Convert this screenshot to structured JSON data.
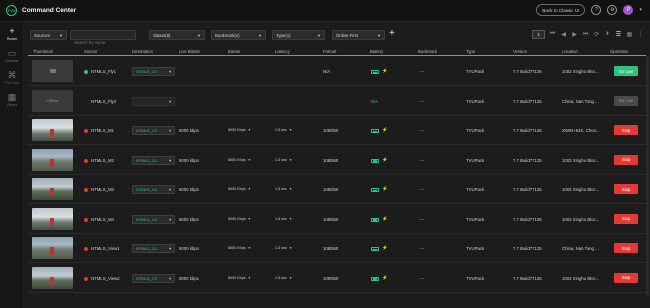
{
  "app": {
    "title": "Command Center",
    "logo_text": "TVU"
  },
  "header": {
    "back_label": "Back to Classic UI",
    "help_glyph": "?",
    "settings_glyph": "⚙",
    "user_initial": "P",
    "caret": "▾"
  },
  "sidebar": {
    "items": [
      {
        "label": "Router",
        "icon": "plus-icon",
        "glyph": "+",
        "active": true
      },
      {
        "label": "Receiver",
        "icon": "monitor-icon",
        "glyph": "▭",
        "active": false
      },
      {
        "label": "TVU Grid",
        "icon": "grid-icon",
        "glyph": "⌘",
        "active": false
      },
      {
        "label": "Others",
        "icon": "apps-icon",
        "glyph": "▦",
        "active": false
      }
    ]
  },
  "filters": {
    "sources": "Sources",
    "search_placeholder": "Search by name",
    "status": "Status(8)",
    "bookmark": "Bookmark(1)",
    "type": "Type(1)",
    "online_first": "Online First",
    "add": "+"
  },
  "tools": {
    "page": "1",
    "glyphs": [
      "⏮",
      "◀",
      "▶",
      "⏭",
      "⟳",
      "⏵",
      "☰",
      "▦",
      "⋮"
    ]
  },
  "columns": [
    "Thumbnail",
    "Source",
    "Destination",
    "Live Bitrate",
    "Bitrate",
    "Latency",
    "Format",
    "Battery",
    "Bookmark",
    "Type",
    "Version",
    "Location",
    "Operation"
  ],
  "colors": {
    "accent": "#2ec27e",
    "stop": "#e53935",
    "online": "#2ec27e",
    "live": "#e53935"
  },
  "rows": [
    {
      "thumb": "empty",
      "status": "online",
      "source": "NTMLS_Fly1",
      "destination": "NTMLS_1O",
      "dest_disabled": false,
      "live_bitrate": "",
      "bitrate": "",
      "latency": "",
      "format": "N/A",
      "battery": "",
      "bookmark": "---",
      "type": "TVUPack",
      "version": "7.7 Build77135",
      "location": "1002 Xinghu Bloc...",
      "operation": "Go Live"
    },
    {
      "thumb": "offline",
      "thumb_text": "Offline",
      "status": "none",
      "source": "NTMLS_Fly2",
      "destination": "",
      "dest_disabled": true,
      "live_bitrate": "",
      "bitrate": "",
      "latency": "",
      "format": "",
      "battery": "N/A",
      "bookmark": "---",
      "type": "TVUPack",
      "version": "7.7 Build77135",
      "location": "China, Nan Tong ...",
      "operation": "Go Live"
    },
    {
      "thumb": "video",
      "status": "live",
      "source": "NTMLS_M1",
      "destination": "NTMLS_1O",
      "dest_disabled": false,
      "live_bitrate": "8000 kbps",
      "bitrate": "8000 Kbps",
      "latency": "1.5 sec",
      "format": "1080i50",
      "battery": "",
      "bookmark": "---",
      "type": "TVUPack",
      "version": "7.7 Build77135",
      "location": "XWID+54K, Chon...",
      "operation": "Stop"
    },
    {
      "thumb": "video",
      "status": "live",
      "source": "NTMLS_M2",
      "destination": "NTMLS_1O",
      "dest_disabled": false,
      "live_bitrate": "8000 kbps",
      "bitrate": "8000 Kbps",
      "latency": "1.5 sec",
      "format": "1080i50",
      "battery": "",
      "bookmark": "---",
      "type": "TVUPack",
      "version": "7.7 Build77135",
      "location": "1002 Xinghu Bloc...",
      "operation": "Stop"
    },
    {
      "thumb": "video",
      "status": "live",
      "source": "NTMLS_M3",
      "destination": "NTMLS_1O",
      "dest_disabled": false,
      "live_bitrate": "8000 kbps",
      "bitrate": "8000 Kbps",
      "latency": "1.5 sec",
      "format": "1080i50",
      "battery": "",
      "bookmark": "---",
      "type": "TVUPack",
      "version": "7.7 Build77135",
      "location": "1002 Xinghu Bloc...",
      "operation": "Stop"
    },
    {
      "thumb": "video",
      "status": "live",
      "source": "NTMLS_M4",
      "destination": "NTMLS_1O",
      "dest_disabled": false,
      "live_bitrate": "8000 kbps",
      "bitrate": "8000 Kbps",
      "latency": "1.5 sec",
      "format": "1080i50",
      "battery": "",
      "bookmark": "---",
      "type": "TVUPack",
      "version": "7.7 Build77135",
      "location": "1002 Xinghu Bloc...",
      "operation": "Stop"
    },
    {
      "thumb": "video",
      "status": "live",
      "source": "NTMLS_View1",
      "destination": "NTMLS_1O",
      "dest_disabled": false,
      "live_bitrate": "8000 kbps",
      "bitrate": "8000 Kbps",
      "latency": "1.5 sec",
      "format": "1080i50",
      "battery": "",
      "bookmark": "---",
      "type": "TVUPack",
      "version": "7.7 Build77135",
      "location": "China, Nan Tong ...",
      "operation": "Stop"
    },
    {
      "thumb": "video",
      "status": "live",
      "source": "NTMLS_View2",
      "destination": "NTMLS_1O",
      "dest_disabled": false,
      "live_bitrate": "8000 kbps",
      "bitrate": "8000 Kbps",
      "latency": "1.5 sec",
      "format": "1080i50",
      "battery": "",
      "bookmark": "---",
      "type": "TVUPack",
      "version": "7.7 Build77135",
      "location": "1002 Xinghu Bloc...",
      "operation": "Stop"
    }
  ]
}
